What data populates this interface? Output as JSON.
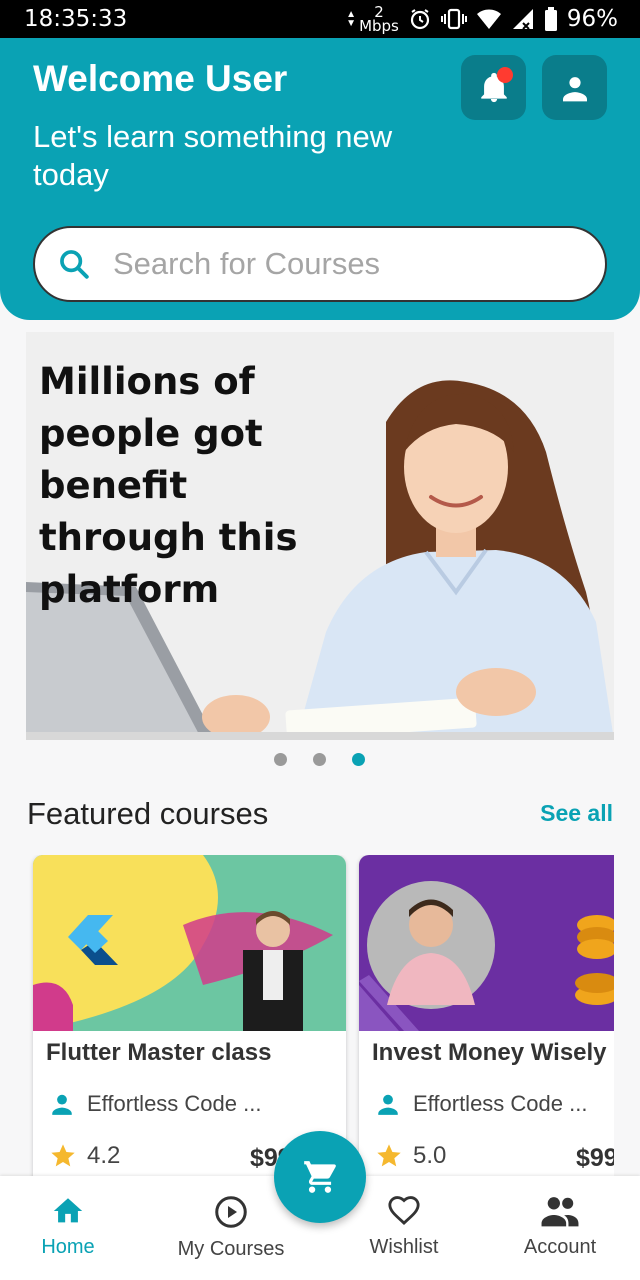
{
  "status_bar": {
    "time": "18:35:33",
    "net_speed_value": "2",
    "net_speed_unit": "Mbps",
    "battery": "96%"
  },
  "header": {
    "title": "Welcome User",
    "subtitle": "Let's learn something new today",
    "search_placeholder": "Search for Courses",
    "notification_badge": true
  },
  "banner": {
    "headline": "Millions of people got benefit through this platform",
    "slide_count": 3,
    "active_slide": 3
  },
  "featured": {
    "title": "Featured courses",
    "see_all": "See all",
    "courses": [
      {
        "title": "Flutter Master class",
        "author": "Effortless Code ...",
        "rating": "4.2",
        "price": "$99"
      },
      {
        "title": "Invest Money Wisely",
        "author": "Effortless Code ...",
        "rating": "5.0",
        "price": "$99"
      }
    ]
  },
  "bottom_nav": {
    "items": [
      {
        "label": "Home",
        "icon": "home-icon",
        "active": true
      },
      {
        "label": "My Courses",
        "icon": "play-circle-icon",
        "active": false
      },
      {
        "label": "Wishlist",
        "icon": "heart-icon",
        "active": false
      },
      {
        "label": "Account",
        "icon": "people-icon",
        "active": false
      }
    ],
    "fab_icon": "cart-icon"
  },
  "colors": {
    "primary": "#0aa2b4",
    "primary_dark": "#0a7d8b",
    "badge": "#ff3b30",
    "star": "#f5b82e"
  }
}
